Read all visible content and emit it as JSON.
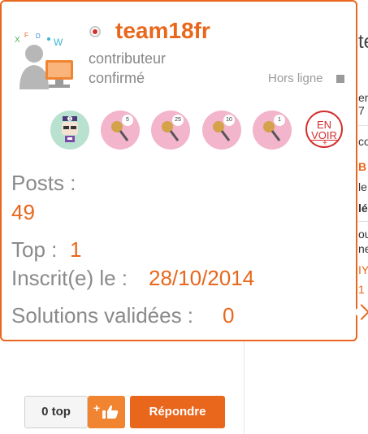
{
  "profile": {
    "username": "team18fr",
    "rank_line1": "contributeur",
    "rank_line2": "confirmé",
    "status": "Hors ligne"
  },
  "badges": [
    {
      "icon": "robot-badge-icon",
      "count": "1",
      "color": "#b9e1cf"
    },
    {
      "icon": "microphone-badge-icon",
      "count": "5",
      "color": "#f2b5cb"
    },
    {
      "icon": "microphone-badge-icon",
      "count": "25",
      "color": "#f2b5cb"
    },
    {
      "icon": "microphone-badge-icon",
      "count": "10",
      "color": "#f2b5cb"
    },
    {
      "icon": "microphone-badge-icon",
      "count": "1",
      "color": "#f2b5cb"
    }
  ],
  "see_more": {
    "line1": "EN",
    "line2": "VOIR",
    "plus": "+"
  },
  "stats": {
    "posts_label": "Posts :",
    "posts_value": "49",
    "top_label": "Top :",
    "top_value": "1",
    "inscrit_label": "Inscrit(e) le :",
    "inscrit_value": "28/10/2014",
    "solutions_label": "Solutions validées :",
    "solutions_value": "0"
  },
  "actions": {
    "top_button": "0 top",
    "like_plus": "+",
    "reply_button": "Répondre"
  },
  "background_fragments": [
    "te",
    "en",
    "7",
    "co",
    "B",
    "le",
    "lé",
    "ou",
    "ne",
    "IY",
    "1"
  ],
  "colors": {
    "accent": "#e8671c",
    "muted": "#8a8a8a",
    "badge_pink": "#f2b5cb",
    "badge_teal": "#b9e1cf"
  }
}
